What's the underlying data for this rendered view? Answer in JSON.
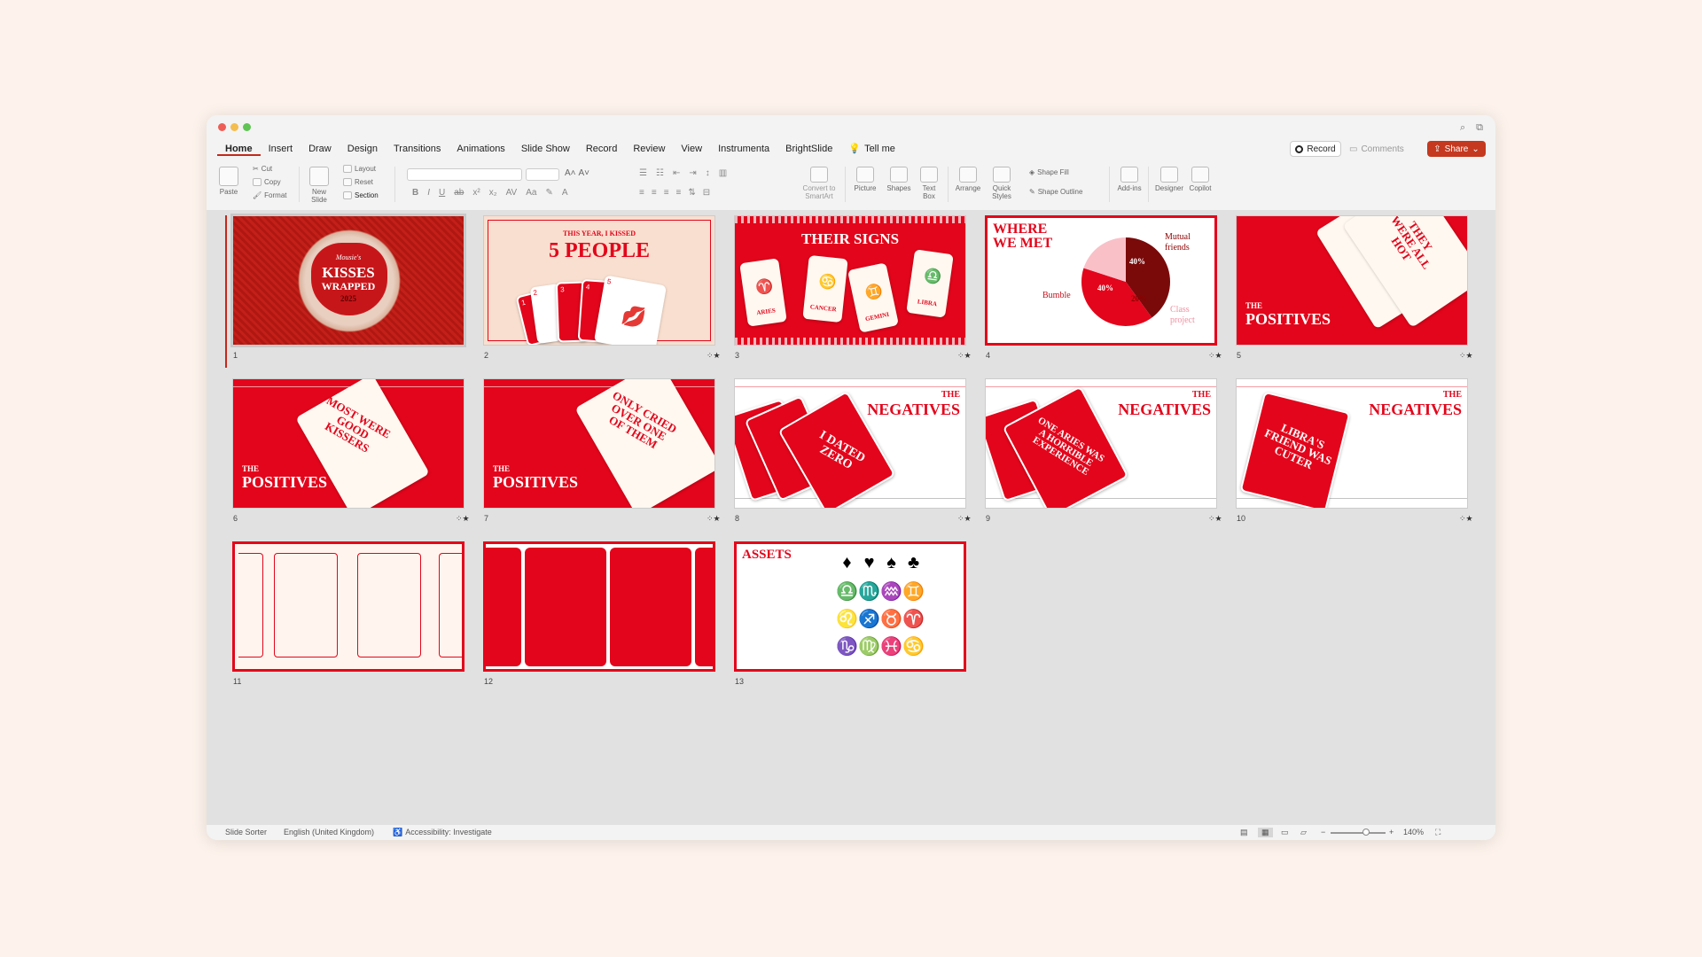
{
  "window": {
    "tabs": [
      "Home",
      "Insert",
      "Draw",
      "Design",
      "Transitions",
      "Animations",
      "Slide Show",
      "Record",
      "Review",
      "View",
      "Instrumenta",
      "BrightSlide"
    ],
    "tell_me": "Tell me",
    "record_label": "Record",
    "comments_label": "Comments",
    "share_label": "Share"
  },
  "ribbon": {
    "paste": "Paste",
    "cut": "Cut",
    "copy": "Copy",
    "format": "Format",
    "new_slide": "New Slide",
    "layout": "Layout",
    "reset": "Reset",
    "section": "Section",
    "convert_smartart": "Convert to SmartArt",
    "picture": "Picture",
    "shapes": "Shapes",
    "text_box": "Text Box",
    "arrange": "Arrange",
    "quick_styles": "Quick Styles",
    "shape_fill": "Shape Fill",
    "shape_outline": "Shape Outline",
    "add_ins": "Add-ins",
    "designer": "Designer",
    "copilot": "Copilot"
  },
  "slides": {
    "numbers": [
      "1",
      "2",
      "3",
      "4",
      "5",
      "6",
      "7",
      "8",
      "9",
      "10",
      "11",
      "12",
      "13"
    ],
    "s1": {
      "script": "Mousie's",
      "line1": "KISSES",
      "line2": "WRAPPED",
      "year": "2025"
    },
    "s2": {
      "line1": "THIS YEAR, I KISSED",
      "line2": "5 PEOPLE",
      "cards": [
        "1",
        "2",
        "3",
        "4",
        "5"
      ]
    },
    "s3": {
      "title": "THEIR SIGNS",
      "cards": [
        "ARIES",
        "CANCER",
        "GEMINI",
        "LIBRA"
      ]
    },
    "s4": {
      "title": "WHERE WE MET",
      "labels": [
        "Mutual friends",
        "Bumble",
        "Class project"
      ],
      "values": [
        "40%",
        "40%",
        "20%"
      ]
    },
    "s5": {
      "small": "THE",
      "big": "POSITIVES",
      "card": "THEY WERE ALL HOT"
    },
    "s6": {
      "small": "THE",
      "big": "POSITIVES",
      "card": "MOST WERE GOOD KISSERS"
    },
    "s7": {
      "small": "THE",
      "big": "POSITIVES",
      "card": "ONLY CRIED OVER ONE OF THEM"
    },
    "s8": {
      "small": "THE",
      "big": "NEGATIVES",
      "card": "I DATED ZERO"
    },
    "s9": {
      "small": "THE",
      "big": "NEGATIVES",
      "card": "ONE ARIES WAS A HORRIBLE EXPERIENCE"
    },
    "s10": {
      "small": "THE",
      "big": "NEGATIVES",
      "card": "LIBRA'S FRIEND WAS CUTER"
    },
    "s13": {
      "title": "ASSETS",
      "symbols": [
        "♦",
        "♥",
        "♠",
        "♣",
        "♎",
        "♏",
        "♒",
        "♊",
        "♌",
        "♐",
        "♉",
        "♈",
        "♑",
        "♍",
        "♓",
        "♋"
      ]
    }
  },
  "status": {
    "view": "Slide Sorter",
    "language": "English (United Kingdom)",
    "accessibility": "Accessibility: Investigate",
    "zoom": "140%"
  },
  "colors": {
    "accent": "#e3051b",
    "share": "#c4391f"
  }
}
